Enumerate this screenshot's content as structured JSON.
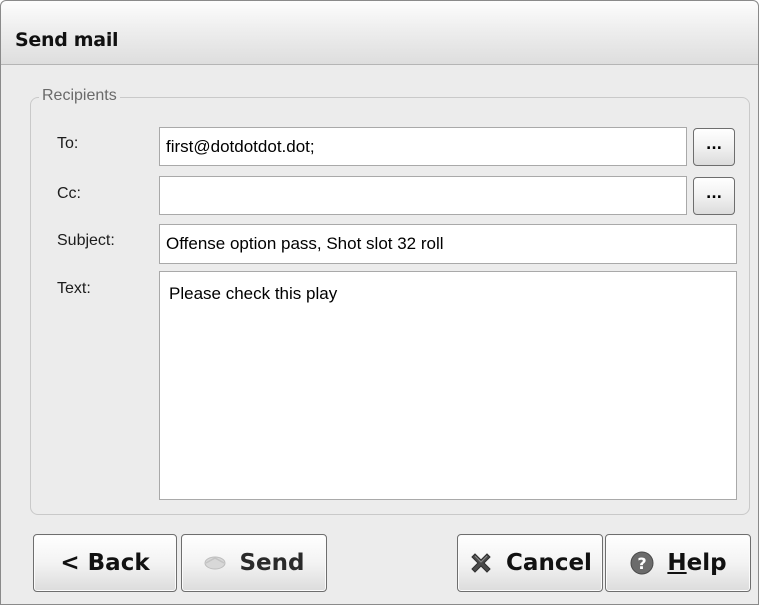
{
  "window": {
    "title": "Send mail"
  },
  "recipients": {
    "group_label": "Recipients",
    "to": {
      "label": "To:",
      "value": "first@dotdotdot.dot;",
      "lookup_label": "..."
    },
    "cc": {
      "label": "Cc:",
      "value": "",
      "lookup_label": "..."
    },
    "subject": {
      "label": "Subject:",
      "value": "Offense option pass, Shot slot 32 roll"
    },
    "text": {
      "label": "Text:",
      "value": "Please check this play"
    }
  },
  "buttons": {
    "back": {
      "label": "< Back"
    },
    "send": {
      "label": "Send",
      "icon": "send-icon"
    },
    "cancel": {
      "label": "Cancel",
      "icon": "cancel-x-icon"
    },
    "help": {
      "label_prefix": "H",
      "label_rest": "elp",
      "icon": "help-question-icon"
    }
  },
  "colors": {
    "window_bg": "#ececec",
    "group_border": "#c9c9c9",
    "help_icon": "#6b6b6b",
    "cancel_icon": "#4a4a4a"
  }
}
